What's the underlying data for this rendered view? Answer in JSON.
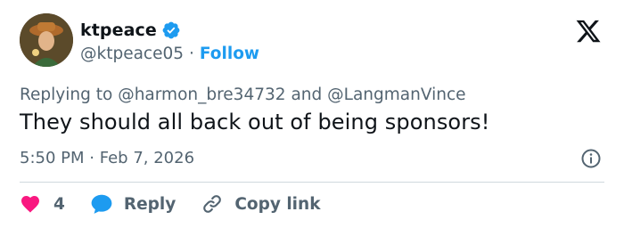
{
  "colors": {
    "link_blue": "#1d9bf0",
    "muted": "#536471",
    "text": "#0f1419",
    "like_red": "#f91880",
    "divider": "#cfd9de"
  },
  "author": {
    "display_name": "ktpeace",
    "handle": "@ktpeace05",
    "separator": "·",
    "follow_label": "Follow",
    "verified_icon": "verified-badge-icon",
    "avatar": "avatar"
  },
  "logo": "x-logo-icon",
  "reply": {
    "prefix": "Replying to",
    "mention1": "@harmon_bre34732",
    "conj": "and",
    "mention2": "@LangmanVince"
  },
  "tweet": {
    "text": "They should all back out of being sponsors!",
    "time": "5:50 PM",
    "separator": "·",
    "date": "Feb 7, 2026",
    "info_icon": "info-icon"
  },
  "actions": {
    "like_icon": "heart-icon",
    "like_count": "4",
    "reply_icon": "reply-bubble-icon",
    "reply_label": "Reply",
    "copy_icon": "link-icon",
    "copy_label": "Copy link"
  }
}
